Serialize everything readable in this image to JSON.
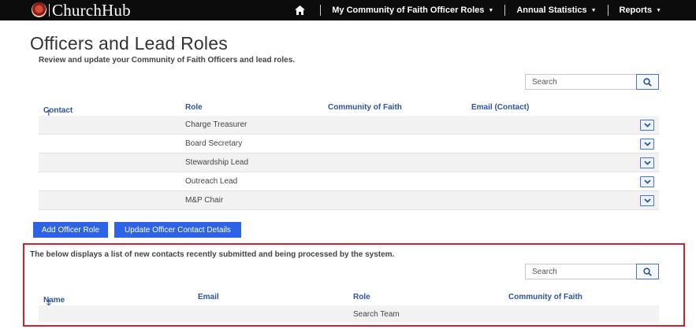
{
  "app": {
    "brand": "ChurchHub",
    "nav": {
      "home_icon": "home-icon",
      "items": [
        {
          "label": "My Community of Faith Officer Roles"
        },
        {
          "label": "Annual Statistics"
        },
        {
          "label": "Reports"
        }
      ]
    }
  },
  "page": {
    "title": "Officers and Lead Roles",
    "subtitle": "Review and update your Community of Faith Officers and lead roles."
  },
  "officers": {
    "search_placeholder": "Search",
    "columns": [
      "Contact",
      "Role",
      "Community of Faith",
      "Email (Contact)"
    ],
    "sort_column": "Contact",
    "sort_direction": "ascending",
    "rows": [
      {
        "contact": "",
        "role": "Charge Treasurer",
        "community": "",
        "email": ""
      },
      {
        "contact": "",
        "role": "Board Secretary",
        "community": "",
        "email": ""
      },
      {
        "contact": "",
        "role": "Stewardship Lead",
        "community": "",
        "email": ""
      },
      {
        "contact": "",
        "role": "Outreach Lead",
        "community": "",
        "email": ""
      },
      {
        "contact": "",
        "role": "M&P Chair",
        "community": "",
        "email": ""
      }
    ],
    "buttons": {
      "add_role": "Add Officer Role",
      "update_contact": "Update Officer Contact Details"
    }
  },
  "pending": {
    "note": "The below displays a list of new contacts recently submitted and being processed by the system.",
    "search_placeholder": "Search",
    "columns": [
      "Name",
      "Email",
      "Role",
      "Community of Faith"
    ],
    "sort_column": "Name",
    "sort_direction": "descending",
    "rows": [
      {
        "name": "",
        "email": "",
        "role": "Search Team",
        "community": ""
      }
    ]
  },
  "colors": {
    "nav_bg": "#0c0c0c",
    "link_blue": "#2d53a3",
    "button_blue": "#2d63e6",
    "highlight_red": "#d6202a"
  }
}
